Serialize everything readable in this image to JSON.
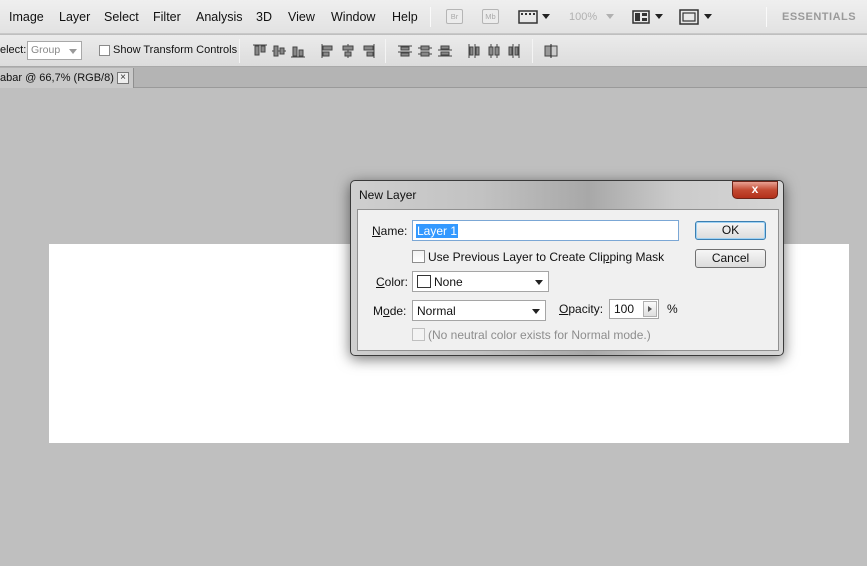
{
  "menu": {
    "items": [
      "Image",
      "Layer",
      "Select",
      "Filter",
      "Analysis",
      "3D",
      "View",
      "Window",
      "Help"
    ],
    "bridge_label": "Br",
    "minibridge_label": "Mb",
    "zoom": "100%",
    "workspace": "ESSENTIALS"
  },
  "options": {
    "select_label": "elect:",
    "select_value": "Group",
    "show_transform_label": "Show Transform Controls"
  },
  "document_tab": {
    "title": "abar @ 66,7% (RGB/8)",
    "close": "×"
  },
  "dialog": {
    "title": "New Layer",
    "close": "x",
    "name_label_u": "N",
    "name_label_rest": "ame:",
    "name_value": "Layer 1",
    "clipping_label_a": "Use Previous Layer to Create Cli",
    "clipping_label_u": "p",
    "clipping_label_b": "ping Mask",
    "color_label_u": "C",
    "color_label_rest": "olor:",
    "color_value": "None",
    "mode_label_a": "M",
    "mode_label_u": "o",
    "mode_label_b": "de:",
    "mode_value": "Normal",
    "opacity_label_u": "O",
    "opacity_label_rest": "pacity:",
    "opacity_value": "100",
    "opacity_unit": "%",
    "neutral_label": "(No neutral color exists for Normal mode.)",
    "ok": "OK",
    "cancel": "Cancel"
  }
}
